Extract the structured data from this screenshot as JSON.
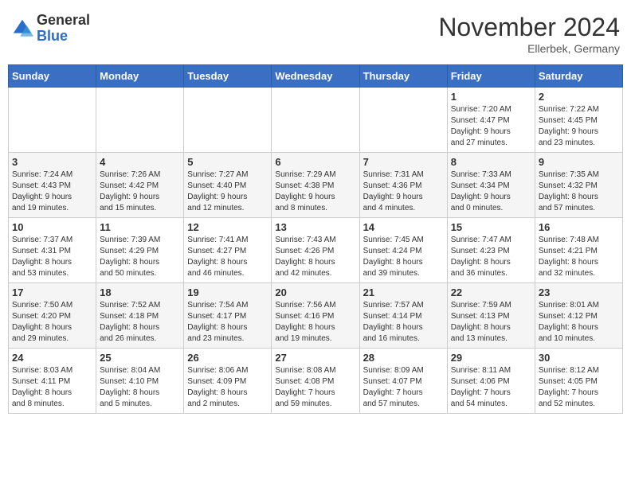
{
  "logo": {
    "general": "General",
    "blue": "Blue"
  },
  "title": "November 2024",
  "location": "Ellerbek, Germany",
  "days_of_week": [
    "Sunday",
    "Monday",
    "Tuesday",
    "Wednesday",
    "Thursday",
    "Friday",
    "Saturday"
  ],
  "weeks": [
    [
      {
        "day": "",
        "info": ""
      },
      {
        "day": "",
        "info": ""
      },
      {
        "day": "",
        "info": ""
      },
      {
        "day": "",
        "info": ""
      },
      {
        "day": "",
        "info": ""
      },
      {
        "day": "1",
        "info": "Sunrise: 7:20 AM\nSunset: 4:47 PM\nDaylight: 9 hours\nand 27 minutes."
      },
      {
        "day": "2",
        "info": "Sunrise: 7:22 AM\nSunset: 4:45 PM\nDaylight: 9 hours\nand 23 minutes."
      }
    ],
    [
      {
        "day": "3",
        "info": "Sunrise: 7:24 AM\nSunset: 4:43 PM\nDaylight: 9 hours\nand 19 minutes."
      },
      {
        "day": "4",
        "info": "Sunrise: 7:26 AM\nSunset: 4:42 PM\nDaylight: 9 hours\nand 15 minutes."
      },
      {
        "day": "5",
        "info": "Sunrise: 7:27 AM\nSunset: 4:40 PM\nDaylight: 9 hours\nand 12 minutes."
      },
      {
        "day": "6",
        "info": "Sunrise: 7:29 AM\nSunset: 4:38 PM\nDaylight: 9 hours\nand 8 minutes."
      },
      {
        "day": "7",
        "info": "Sunrise: 7:31 AM\nSunset: 4:36 PM\nDaylight: 9 hours\nand 4 minutes."
      },
      {
        "day": "8",
        "info": "Sunrise: 7:33 AM\nSunset: 4:34 PM\nDaylight: 9 hours\nand 0 minutes."
      },
      {
        "day": "9",
        "info": "Sunrise: 7:35 AM\nSunset: 4:32 PM\nDaylight: 8 hours\nand 57 minutes."
      }
    ],
    [
      {
        "day": "10",
        "info": "Sunrise: 7:37 AM\nSunset: 4:31 PM\nDaylight: 8 hours\nand 53 minutes."
      },
      {
        "day": "11",
        "info": "Sunrise: 7:39 AM\nSunset: 4:29 PM\nDaylight: 8 hours\nand 50 minutes."
      },
      {
        "day": "12",
        "info": "Sunrise: 7:41 AM\nSunset: 4:27 PM\nDaylight: 8 hours\nand 46 minutes."
      },
      {
        "day": "13",
        "info": "Sunrise: 7:43 AM\nSunset: 4:26 PM\nDaylight: 8 hours\nand 42 minutes."
      },
      {
        "day": "14",
        "info": "Sunrise: 7:45 AM\nSunset: 4:24 PM\nDaylight: 8 hours\nand 39 minutes."
      },
      {
        "day": "15",
        "info": "Sunrise: 7:47 AM\nSunset: 4:23 PM\nDaylight: 8 hours\nand 36 minutes."
      },
      {
        "day": "16",
        "info": "Sunrise: 7:48 AM\nSunset: 4:21 PM\nDaylight: 8 hours\nand 32 minutes."
      }
    ],
    [
      {
        "day": "17",
        "info": "Sunrise: 7:50 AM\nSunset: 4:20 PM\nDaylight: 8 hours\nand 29 minutes."
      },
      {
        "day": "18",
        "info": "Sunrise: 7:52 AM\nSunset: 4:18 PM\nDaylight: 8 hours\nand 26 minutes."
      },
      {
        "day": "19",
        "info": "Sunrise: 7:54 AM\nSunset: 4:17 PM\nDaylight: 8 hours\nand 23 minutes."
      },
      {
        "day": "20",
        "info": "Sunrise: 7:56 AM\nSunset: 4:16 PM\nDaylight: 8 hours\nand 19 minutes."
      },
      {
        "day": "21",
        "info": "Sunrise: 7:57 AM\nSunset: 4:14 PM\nDaylight: 8 hours\nand 16 minutes."
      },
      {
        "day": "22",
        "info": "Sunrise: 7:59 AM\nSunset: 4:13 PM\nDaylight: 8 hours\nand 13 minutes."
      },
      {
        "day": "23",
        "info": "Sunrise: 8:01 AM\nSunset: 4:12 PM\nDaylight: 8 hours\nand 10 minutes."
      }
    ],
    [
      {
        "day": "24",
        "info": "Sunrise: 8:03 AM\nSunset: 4:11 PM\nDaylight: 8 hours\nand 8 minutes."
      },
      {
        "day": "25",
        "info": "Sunrise: 8:04 AM\nSunset: 4:10 PM\nDaylight: 8 hours\nand 5 minutes."
      },
      {
        "day": "26",
        "info": "Sunrise: 8:06 AM\nSunset: 4:09 PM\nDaylight: 8 hours\nand 2 minutes."
      },
      {
        "day": "27",
        "info": "Sunrise: 8:08 AM\nSunset: 4:08 PM\nDaylight: 7 hours\nand 59 minutes."
      },
      {
        "day": "28",
        "info": "Sunrise: 8:09 AM\nSunset: 4:07 PM\nDaylight: 7 hours\nand 57 minutes."
      },
      {
        "day": "29",
        "info": "Sunrise: 8:11 AM\nSunset: 4:06 PM\nDaylight: 7 hours\nand 54 minutes."
      },
      {
        "day": "30",
        "info": "Sunrise: 8:12 AM\nSunset: 4:05 PM\nDaylight: 7 hours\nand 52 minutes."
      }
    ]
  ]
}
